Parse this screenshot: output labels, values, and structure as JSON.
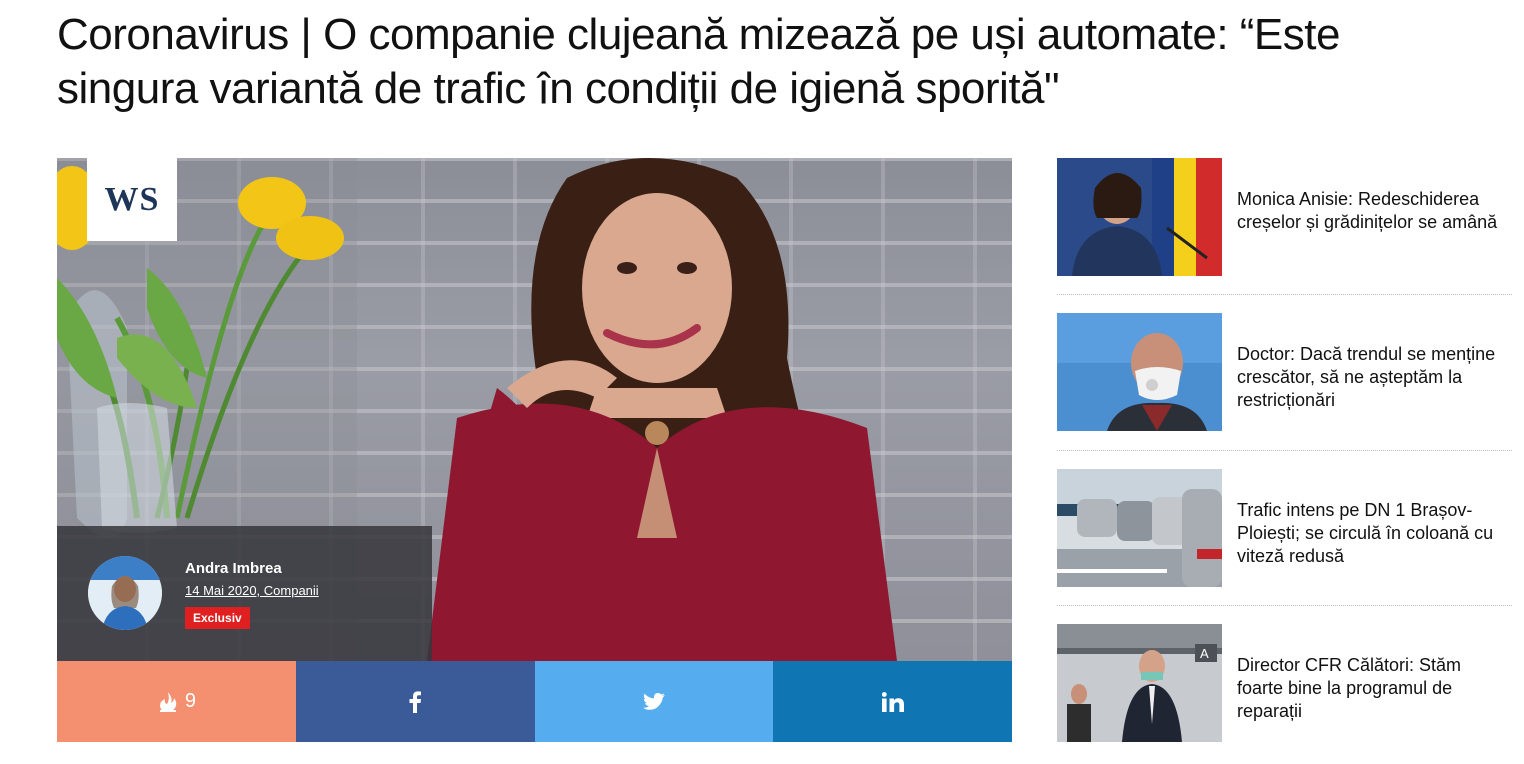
{
  "article": {
    "headline": "Coronavirus | O companie clujeană mizează pe uși automate: “Este singura variantă de trafic în condiții de igienă sporită\"",
    "logo_text": "WS",
    "author": {
      "name": "Andra Imbrea",
      "meta": "14 Mai 2020, Companii",
      "badge": "Exclusiv"
    }
  },
  "share": {
    "fire_count": "9",
    "buttons": [
      {
        "name": "fire",
        "icon": "flame-icon",
        "color": "#f4906f"
      },
      {
        "name": "facebook",
        "icon": "facebook-icon",
        "color": "#3b5b98"
      },
      {
        "name": "twitter",
        "icon": "twitter-icon",
        "color": "#55acee"
      },
      {
        "name": "linkedin",
        "icon": "linkedin-icon",
        "color": "#0f76b3"
      }
    ]
  },
  "sidebar": {
    "items": [
      {
        "title": "Monica Anisie: Redeschiderea creșelor și grădinițelor se amână"
      },
      {
        "title": "Doctor: Dacă trendul se menține crescător, să ne așteptăm la restricționări"
      },
      {
        "title": "Trafic intens pe DN 1 Brașov-Ploiești; se circulă în coloană cu viteză redusă"
      },
      {
        "title": "Director CFR Călători: Stăm foarte bine la programul de reparații"
      }
    ]
  },
  "colors": {
    "badge": "#e02020",
    "author_panel": "#37373c",
    "logo": "#1d3557"
  }
}
